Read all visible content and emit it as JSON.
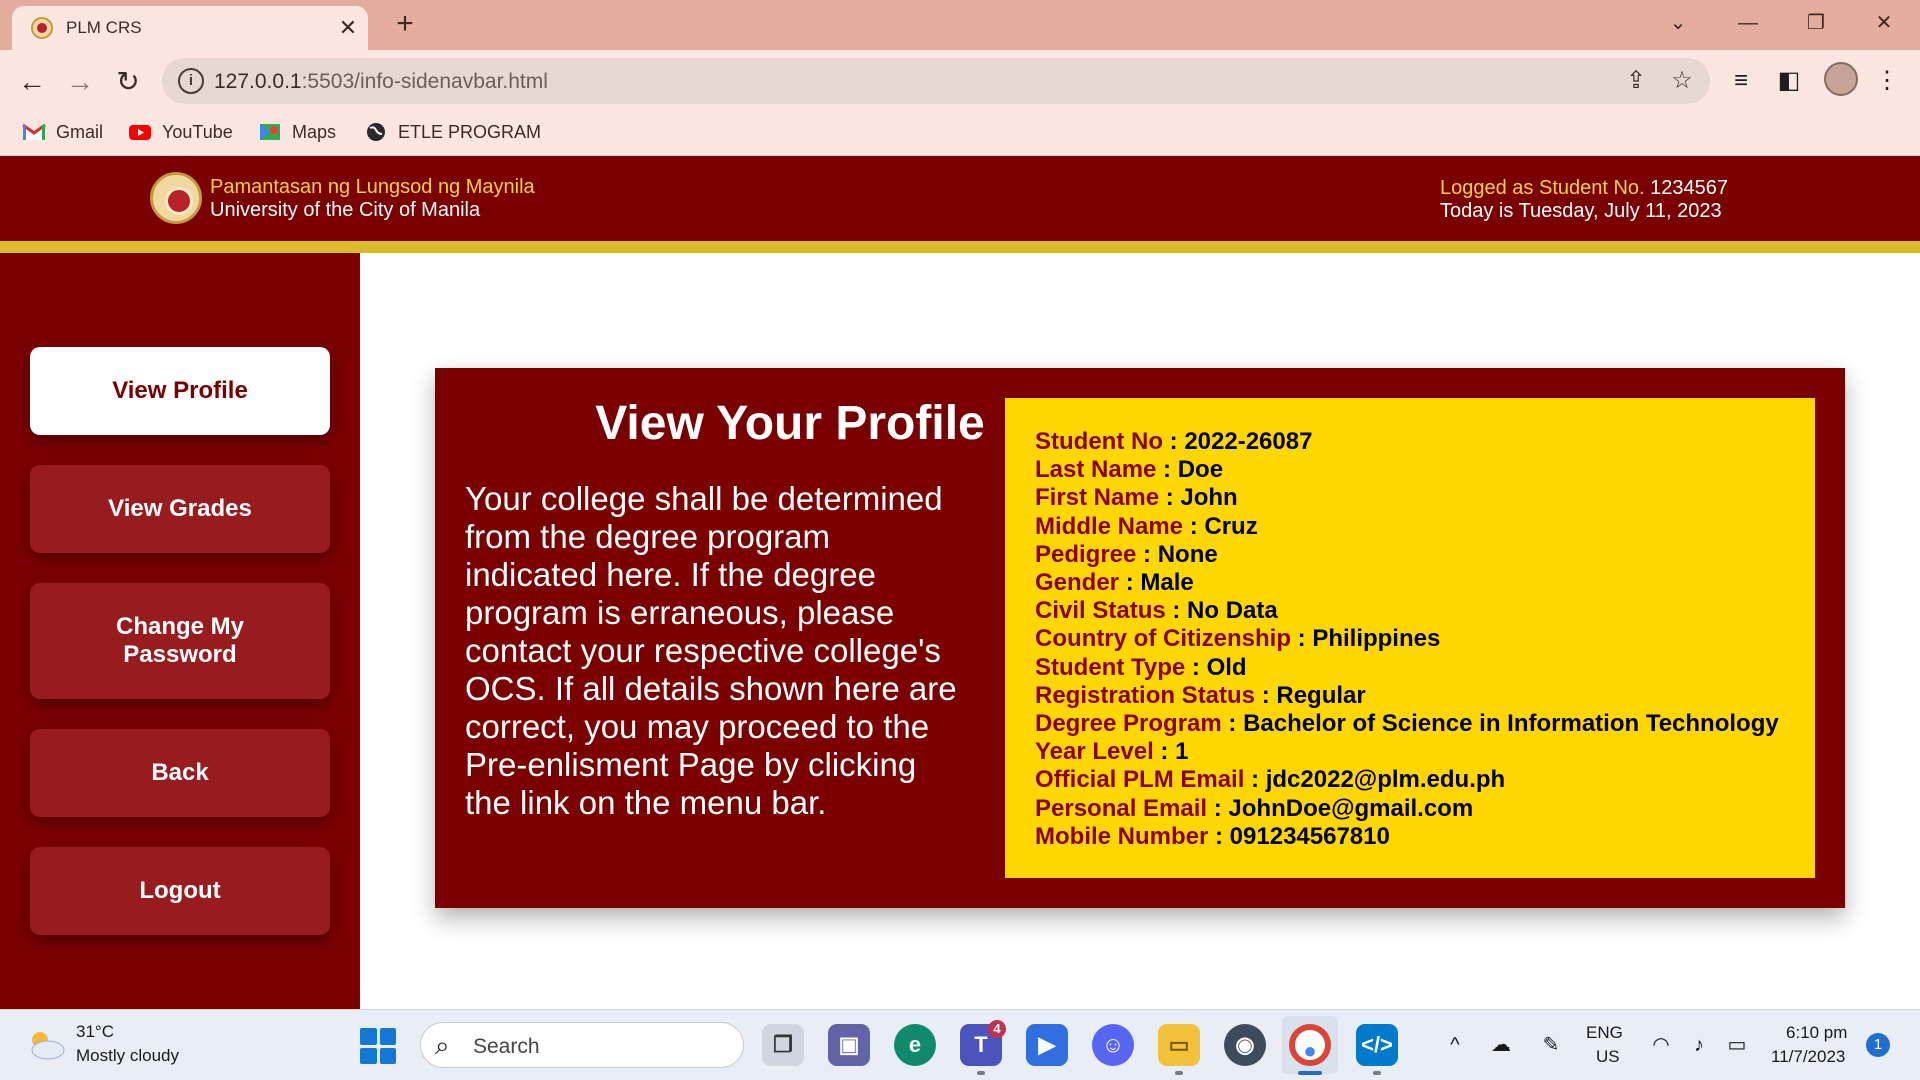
{
  "browser": {
    "tab_title": "PLM CRS",
    "tab_close": "✕",
    "new_tab": "+",
    "url_host": "127.0.0.1",
    "url_path": ":5503/info-sidenavbar.html",
    "bookmarks": [
      "Gmail",
      "YouTube",
      "Maps",
      "ETLE PROGRAM"
    ]
  },
  "header": {
    "university_local": "Pamantasan ng Lungsod ng Maynila",
    "university_english": "University of the City of Manila",
    "logged_prefix": "Logged as Student No.",
    "student_number": "1234567",
    "today": "Today is Tuesday, July 11, 2023"
  },
  "sidebar": {
    "items": [
      {
        "label": "View Profile"
      },
      {
        "label": "View Grades"
      },
      {
        "label": "Change My Password"
      },
      {
        "label": "Back"
      },
      {
        "label": "Logout"
      }
    ]
  },
  "main": {
    "title": "View Your Profile",
    "instructions": "Your college shall be determined from the degree program indicated here. If the degree program is erraneous, please contact your respective college's OCS. If all details shown here are correct, you may proceed to the Pre-enlisment Page by clicking the link on the menu bar.",
    "profile": [
      {
        "label": "Student No",
        "value": "2022-26087"
      },
      {
        "label": "Last Name",
        "value": "Doe"
      },
      {
        "label": "First Name",
        "value": "John"
      },
      {
        "label": "Middle Name",
        "value": "Cruz"
      },
      {
        "label": "Pedigree",
        "value": "None"
      },
      {
        "label": "Gender",
        "value": "Male"
      },
      {
        "label": "Civil Status",
        "value": "No Data"
      },
      {
        "label": "Country of Citizenship",
        "value": "Philippines"
      },
      {
        "label": "Student Type",
        "value": "Old"
      },
      {
        "label": "Registration Status",
        "value": "Regular"
      },
      {
        "label": "Degree Program",
        "value": "Bachelor of Science in Information Technology"
      },
      {
        "label": "Year Level",
        "value": "1"
      },
      {
        "label": "Official PLM Email",
        "value": "jdc2022@plm.edu.ph"
      },
      {
        "label": "Personal Email",
        "value": "JohnDoe@gmail.com"
      },
      {
        "label": "Mobile Number",
        "value": "091234567810"
      }
    ],
    "separator": " : "
  },
  "colors": {
    "maroon": "#7a0000",
    "button": "#981b1e",
    "gold": "#ffd700",
    "stripe": "#d9bb2b",
    "label": "#8b0000"
  },
  "taskbar": {
    "temperature": "31°C",
    "weather": "Mostly cloudy",
    "search_placeholder": "Search",
    "teams_badge": "4",
    "lang_line1": "ENG",
    "lang_line2": "US",
    "time": "6:10 pm",
    "date": "11/7/2023",
    "notifications": "1"
  }
}
